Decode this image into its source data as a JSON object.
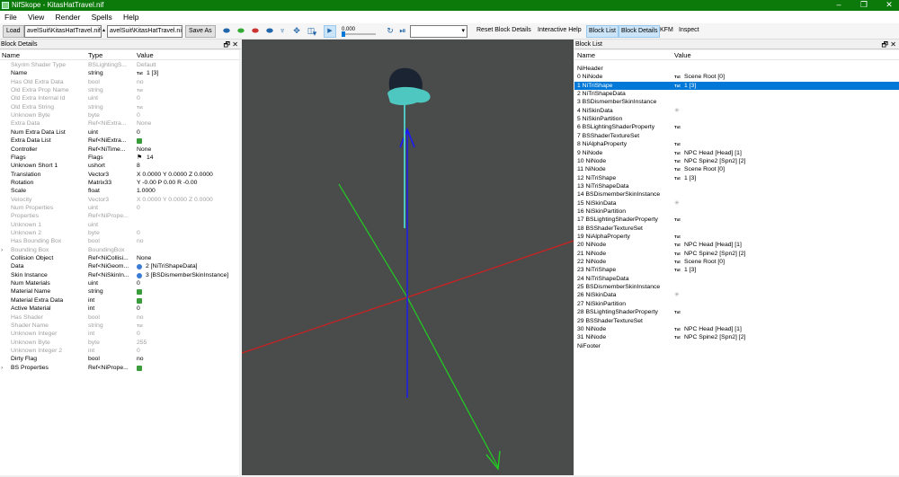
{
  "window": {
    "title": "NifSkope - KitasHatTravel.nif",
    "minimize": "–",
    "maximize": "❐",
    "close": "✕"
  },
  "menu": [
    "File",
    "View",
    "Render",
    "Spells",
    "Help"
  ],
  "toolbar": {
    "load": "Load",
    "load_path": "avelSuit\\KitasHatTravel.nif",
    "save_path": "avelSuit\\KitasHatTravel.nif",
    "save_as": "Save As",
    "time_value": "0.000",
    "reset_block_details": "Reset Block Details",
    "interactive_help": "Interactive Help",
    "block_list": "Block List",
    "block_details": "Block Details",
    "kfm": "KFM",
    "inspect": "Inspect"
  },
  "block_details": {
    "panel_title": "Block Details",
    "columns": [
      "Name",
      "Type",
      "Value"
    ],
    "rows": [
      {
        "name": "Skyrim Shader Type",
        "type": "BSLightingS...",
        "value": "Default",
        "dim": true
      },
      {
        "name": "Name",
        "type": "string",
        "value": "1 [3]",
        "txt": true
      },
      {
        "name": "Has Old Extra Data",
        "type": "bool",
        "value": "no",
        "dim": true
      },
      {
        "name": "Old Extra Prop Name",
        "type": "string",
        "value": "",
        "txt": true,
        "dim": true
      },
      {
        "name": "Old Extra Internal Id",
        "type": "uint",
        "value": "0",
        "dim": true
      },
      {
        "name": "Old Extra String",
        "type": "string",
        "value": "",
        "txt": true,
        "dim": true
      },
      {
        "name": "Unknown Byte",
        "type": "byte",
        "value": "0",
        "dim": true
      },
      {
        "name": "Extra Data",
        "type": "Ref<NiExtra...",
        "value": "None",
        "dim": true
      },
      {
        "name": "Num Extra Data List",
        "type": "uint",
        "value": "0"
      },
      {
        "name": "Extra Data List",
        "type": "Ref<NiExtra...",
        "value": "",
        "green": true
      },
      {
        "name": "Controller",
        "type": "Ref<NiTime...",
        "value": "None"
      },
      {
        "name": "Flags",
        "type": "Flags",
        "value": "14",
        "flag": true
      },
      {
        "name": "Unknown Short 1",
        "type": "ushort",
        "value": "8"
      },
      {
        "name": "Translation",
        "type": "Vector3",
        "value": "X 0.0000 Y 0.0000 Z 0.0000"
      },
      {
        "name": "Rotation",
        "type": "Matrix33",
        "value": "Y -0.00 P 0.00 R -0.00"
      },
      {
        "name": "Scale",
        "type": "float",
        "value": "1.0000"
      },
      {
        "name": "Velocity",
        "type": "Vector3",
        "value": "X 0.0000 Y 0.0000 Z 0.0000",
        "dim": true
      },
      {
        "name": "Num Properties",
        "type": "uint",
        "value": "0",
        "dim": true
      },
      {
        "name": "Properties",
        "type": "Ref<NiPrope...",
        "value": "",
        "dim": true
      },
      {
        "name": "Unknown 1",
        "type": "uint",
        "value": "",
        "dim": true
      },
      {
        "name": "Unknown 2",
        "type": "byte",
        "value": "0",
        "dim": true
      },
      {
        "name": "Has Bounding Box",
        "type": "bool",
        "value": "no",
        "dim": true
      },
      {
        "name": "Bounding Box",
        "type": "BoundingBox",
        "value": "",
        "dim": true,
        "expand": true
      },
      {
        "name": "Collision Object",
        "type": "Ref<NiCollisi...",
        "value": "None"
      },
      {
        "name": "Data",
        "type": "Ref<NiGeom...",
        "value": "2 [NiTriShapeData]",
        "blue": true
      },
      {
        "name": "Skin Instance",
        "type": "Ref<NiSkinIn...",
        "value": "3 [BSDismemberSkinInstance]",
        "blue": true
      },
      {
        "name": "Num Materials",
        "type": "uint",
        "value": "0"
      },
      {
        "name": "Material Name",
        "type": "string",
        "value": "",
        "green": true
      },
      {
        "name": "Material Extra Data",
        "type": "int",
        "value": "",
        "green": true
      },
      {
        "name": "Active Material",
        "type": "int",
        "value": "0"
      },
      {
        "name": "Has Shader",
        "type": "bool",
        "value": "no",
        "dim": true
      },
      {
        "name": "Shader Name",
        "type": "string",
        "value": "",
        "txt": true,
        "dim": true
      },
      {
        "name": "Unknown Integer",
        "type": "int",
        "value": "0",
        "dim": true
      },
      {
        "name": "Unknown Byte",
        "type": "byte",
        "value": "255",
        "dim": true
      },
      {
        "name": "Unknown Integer 2",
        "type": "int",
        "value": "0",
        "dim": true
      },
      {
        "name": "Dirty Flag",
        "type": "bool",
        "value": "no"
      },
      {
        "name": "BS Properties",
        "type": "Ref<NiPrope...",
        "value": "",
        "green": true,
        "expand": true
      }
    ]
  },
  "block_list": {
    "panel_title": "Block List",
    "columns": [
      "Name",
      "Value"
    ],
    "rows": [
      {
        "name": "NiHeader",
        "value": ""
      },
      {
        "name": "0 NiNode",
        "value": "Scene Root [0]",
        "txt": true
      },
      {
        "name": "1 NiTriShape",
        "value": "1 [3]",
        "txt": true,
        "selected": true
      },
      {
        "name": "2 NiTriShapeData",
        "value": ""
      },
      {
        "name": "3 BSDismemberSkinInstance",
        "value": ""
      },
      {
        "name": "4 NiSkinData",
        "value": "",
        "star": true
      },
      {
        "name": "5 NiSkinPartition",
        "value": ""
      },
      {
        "name": "6 BSLightingShaderProperty",
        "value": "",
        "txt": true
      },
      {
        "name": "7 BSShaderTextureSet",
        "value": ""
      },
      {
        "name": "8 NiAlphaProperty",
        "value": "",
        "txt": true
      },
      {
        "name": "9 NiNode",
        "value": "NPC Head [Head] [1]",
        "txt": true
      },
      {
        "name": "10 NiNode",
        "value": "NPC Spine2 [Spn2] [2]",
        "txt": true
      },
      {
        "name": "11 NiNode",
        "value": "Scene Root [0]",
        "txt": true
      },
      {
        "name": "12 NiTriShape",
        "value": "1 [3]",
        "txt": true
      },
      {
        "name": "13 NiTriShapeData",
        "value": ""
      },
      {
        "name": "14 BSDismemberSkinInstance",
        "value": ""
      },
      {
        "name": "15 NiSkinData",
        "value": "",
        "star": true
      },
      {
        "name": "16 NiSkinPartition",
        "value": ""
      },
      {
        "name": "17 BSLightingShaderProperty",
        "value": "",
        "txt": true
      },
      {
        "name": "18 BSShaderTextureSet",
        "value": ""
      },
      {
        "name": "19 NiAlphaProperty",
        "value": "",
        "txt": true
      },
      {
        "name": "20 NiNode",
        "value": "NPC Head [Head] [1]",
        "txt": true
      },
      {
        "name": "21 NiNode",
        "value": "NPC Spine2 [Spn2] [2]",
        "txt": true
      },
      {
        "name": "22 NiNode",
        "value": "Scene Root [0]",
        "txt": true
      },
      {
        "name": "23 NiTriShape",
        "value": "1 [3]",
        "txt": true
      },
      {
        "name": "24 NiTriShapeData",
        "value": ""
      },
      {
        "name": "25 BSDismemberSkinInstance",
        "value": ""
      },
      {
        "name": "26 NiSkinData",
        "value": "",
        "star": true
      },
      {
        "name": "27 NiSkinPartition",
        "value": ""
      },
      {
        "name": "28 BSLightingShaderProperty",
        "value": "",
        "txt": true
      },
      {
        "name": "29 BSShaderTextureSet",
        "value": ""
      },
      {
        "name": "30 NiNode",
        "value": "NPC Head [Head] [1]",
        "txt": true
      },
      {
        "name": "31 NiNode",
        "value": "NPC Spine2 [Spn2] [2]",
        "txt": true
      },
      {
        "name": "NiFooter",
        "value": ""
      }
    ]
  },
  "icons": {
    "txt": "Txt",
    "star": "✳",
    "flag": "⚑",
    "expand": "›",
    "pin": "🗗",
    "close": "✕"
  },
  "colors": {
    "titlebar": "#0b7a0b",
    "selection": "#0078d7",
    "viewport": "#4a4b4b",
    "axis_x": "#d02020",
    "axis_y": "#20d020",
    "axis_z": "#1a1aff",
    "mesh_teal": "#4ec7c0",
    "mesh_dark": "#1b2433"
  }
}
